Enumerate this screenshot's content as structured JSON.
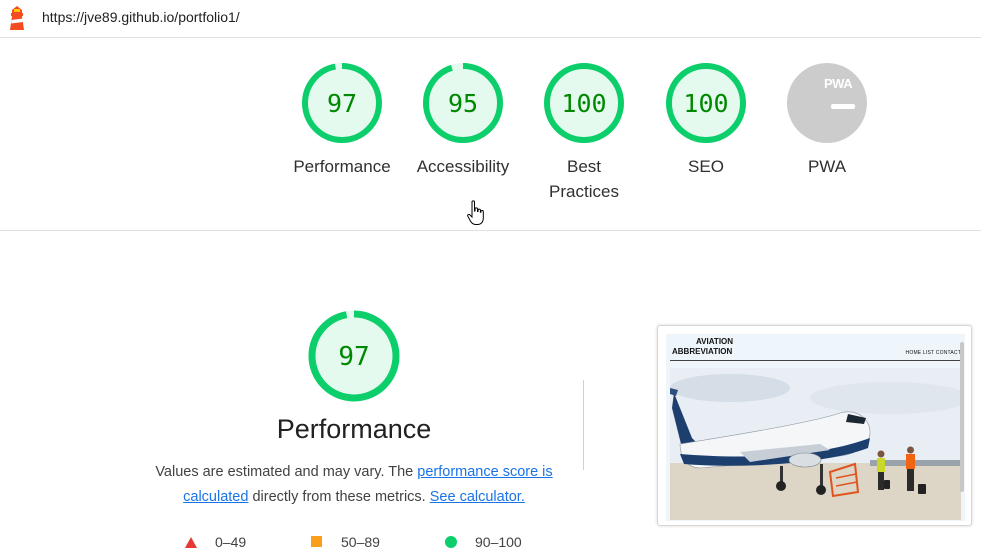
{
  "topbar": {
    "url": "https://jve89.github.io/portfolio1/",
    "logo_icon": "lighthouse-icon"
  },
  "gauges": [
    {
      "score": "97",
      "label": "Performance",
      "color": "#0cce6b"
    },
    {
      "score": "95",
      "label": "Accessibility",
      "color": "#0cce6b"
    },
    {
      "score": "100",
      "label": "Best Practices",
      "color": "#0cce6b"
    },
    {
      "score": "100",
      "label": "SEO",
      "color": "#0cce6b"
    },
    {
      "score": "—",
      "label": "PWA",
      "badge": "PWA",
      "color": "#cccccc"
    }
  ],
  "performance": {
    "score": "97",
    "title": "Performance",
    "desc_text_1": "Values are estimated and may vary. The ",
    "desc_link_1": "performance score is calculated",
    "desc_text_2": " directly from these metrics. ",
    "desc_link_2": "See calculator."
  },
  "legend": [
    {
      "range": "0–49",
      "icon": "triangle-icon",
      "color": "#e53935"
    },
    {
      "range": "50–89",
      "icon": "square-icon",
      "color": "#fa9f1b"
    },
    {
      "range": "90–100",
      "icon": "circle-icon",
      "color": "#0cce6b"
    }
  ],
  "screenshot": {
    "site_title_line1": "AVIATION",
    "site_title_line2": "ABBREVIATION",
    "nav": "HOME  LIST  CONTACT"
  },
  "colors": {
    "pass": "#0cce6b",
    "pass_text": "#008800",
    "pass_fill": "#e5faef",
    "link": "#1a73e8"
  }
}
